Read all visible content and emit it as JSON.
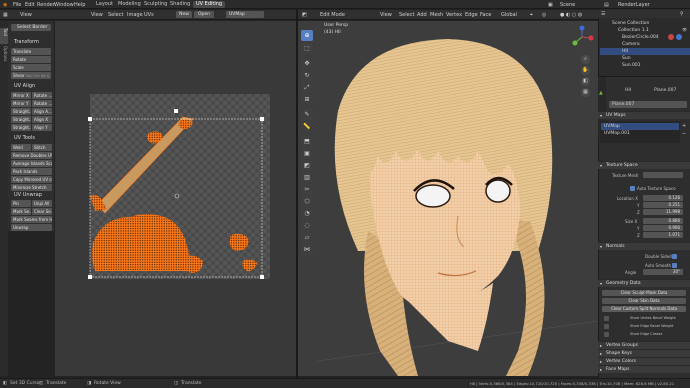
{
  "topbar": {
    "menus": [
      "File",
      "Edit",
      "Render",
      "Window",
      "Help"
    ],
    "workspaces": [
      "Layout",
      "Modeling",
      "Sculpting",
      "Shading",
      "UV Editing"
    ],
    "active_workspace": "UV Editing",
    "scene": "Scene",
    "view_layer": "RenderLayer"
  },
  "uv_editor": {
    "header": {
      "view": "View",
      "menus": [
        "View",
        "Select",
        "Image",
        "UVs"
      ],
      "new": "New",
      "open": "Open",
      "image_name": "UVMap"
    },
    "sidebar_tabs": [
      "Tool",
      "Options"
    ],
    "search_border": "Select Border",
    "transform": {
      "title": "Transform",
      "buttons": [
        "Translate",
        "Rotate",
        "Scale",
        "Shear"
      ],
      "shear_value": "Shif Ctrl Alt S"
    },
    "uv_align": {
      "title": "UV Align",
      "rows": [
        [
          "Mirror X",
          "Rotate ..."
        ],
        [
          "Mirror Y",
          "Rotate ..."
        ],
        [
          "Straight...",
          "Align A..."
        ],
        [
          "Straight...",
          "Align X"
        ],
        [
          "Straight...",
          "Align Y"
        ]
      ]
    },
    "uv_tools": {
      "title": "UV Tools",
      "weld": "Weld",
      "stitch": "Stitch",
      "buttons": [
        "Remove Doubles UV",
        "Average Islands Scale",
        "Pack Islands",
        "Copy Mirrored UV co...",
        "Minimize Stretch"
      ]
    },
    "uv_unwrap": {
      "title": "UV Unwrap",
      "pin": "Pin",
      "unpin": "Unpi All",
      "mark_seam": "Mark Se...",
      "clear_seam": "Clear Se...",
      "mark_seams_from": "Mark Seams from Isl...",
      "unwrap": "Unwrap"
    }
  },
  "viewport": {
    "header": {
      "mode": "Edit Mode",
      "menus": [
        "View",
        "Select",
        "Add",
        "Mesh",
        "Vertex",
        "Edge",
        "Face"
      ],
      "orientation": "Global"
    },
    "overlay_text": [
      "User Persp",
      "(43) HII"
    ],
    "tools": [
      "cursor-icon",
      "select-icon",
      "move-icon",
      "rotate-icon",
      "scale-icon",
      "transform-icon",
      "annotate-icon",
      "measure-icon",
      "extrude-icon",
      "inset-icon",
      "bevel-icon",
      "loopcut-icon",
      "knife-icon",
      "polybuild-icon",
      "spin-icon",
      "smooth-icon",
      "shear-icon",
      "rip-icon"
    ]
  },
  "outliner": {
    "title": "Scene Collection",
    "items": [
      "Scene Collection",
      "Collection 1.1",
      "BezierCircle.004",
      "Camera",
      "HII",
      "Sun",
      "Sun.001"
    ]
  },
  "properties": {
    "breadcrumb": [
      "HII",
      "Plane.007"
    ],
    "object_name": "Plane.007",
    "uv_maps": {
      "title": "UV Maps",
      "items": [
        "UVMap",
        "UVMap.001"
      ]
    },
    "texture_space": {
      "title": "Texture Space",
      "texture_mesh": "Texture Mesh",
      "auto_texture_space": "Auto Texture Space",
      "location_label": "Location X",
      "location": [
        "0.126",
        "0.251",
        "11.998"
      ],
      "size_label": "Size X",
      "size": [
        "0.866",
        "0.906",
        "1.071"
      ],
      "axis_labels": [
        "Location X",
        "Y",
        "Z",
        "Size X",
        "Y",
        "Z"
      ]
    },
    "normals": {
      "title": "Normals",
      "double_sided": "Double Sided",
      "auto_smooth": "Auto Smooth",
      "angle_label": "Angle",
      "angle": "30°"
    },
    "geometry_data": {
      "title": "Geometry Data",
      "buttons": [
        "Clear Sculpt-Mask Data",
        "Clear Skin Data",
        "Clear Custom Split Normals Data"
      ],
      "checks": [
        "Store Vertex Bevel Weight",
        "Store Edge Bevel Weight",
        "Store Edge Crease"
      ]
    },
    "sections": [
      "Vertex Groups",
      "Shape Keys",
      "Vertex Colors",
      "Face Maps"
    ]
  },
  "statusbar": {
    "left": [
      "Set 3D Cursor",
      "Translate",
      "Rotate View",
      "Translate"
    ],
    "stats": "HII | Verts:5,366/5,384 | Edges:10,720/10,720 | Faces:5,338/5,338 | Tris:10,708 | Mem: 628.6 MB | v2.80.21"
  },
  "colors": {
    "accent": "#5680c2",
    "uv_orange": "#ff7a1a",
    "hair": "#e3c28c",
    "skin": "#f2d3b0"
  }
}
